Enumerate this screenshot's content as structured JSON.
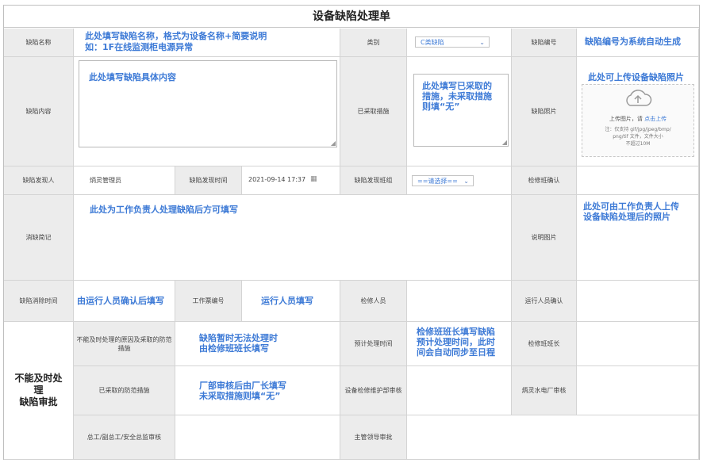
{
  "title": "设备缺陷处理单",
  "row1": {
    "name_label": "缺陷名称",
    "name_hint_line1": "此处填写缺陷名称，格式为设备名称+简要说明",
    "name_hint_line2": "如：1F在线监测柜电源异常",
    "type_label": "类别",
    "type_value": "C类缺陷",
    "code_label": "缺陷编号",
    "code_hint": "缺陷编号为系统自动生成"
  },
  "row2": {
    "content_label": "缺陷内容",
    "content_hint": "此处填写缺陷具体内容",
    "measures_label": "已采取措施",
    "measures_hint_line1": "此处填写已采取的",
    "measures_hint_line2": "措施，未采取措施",
    "measures_hint_line3": "则填“无”",
    "photo_label": "缺陷照片",
    "photo_hint": "此处可上传设备缺陷照片",
    "upload_text": "上传图片，请",
    "upload_link": "点击上传",
    "upload_note_line1": "注：仅支持 gif/jpg/jpeg/bmp/",
    "upload_note_line2": "png/tif 文件，文件大小",
    "upload_note_line3": "不超过10M"
  },
  "row3": {
    "finder_label": "缺陷发现人",
    "finder_value": "炳灵管理员",
    "time_label": "缺陷发现时间",
    "time_value": "2021-09-14 17:37",
    "team_label": "缺陷发现班组",
    "team_value": "==请选择==",
    "confirm_label": "检修班确认"
  },
  "row4": {
    "record_label": "消缺简记",
    "record_hint": "此处为工作负责人处理缺陷后方可填写",
    "photo_label": "说明图片",
    "photo_hint_line1": "此处可由工作负责人上传",
    "photo_hint_line2": "设备缺陷处理后的照片"
  },
  "row5": {
    "elim_label": "缺陷消除时间",
    "elim_hint": "由运行人员确认后填写",
    "ticket_label": "工作票编号",
    "ticket_hint": "运行人员填写",
    "repair_label": "检修人员",
    "op_confirm_label": "运行人员确认"
  },
  "approval": {
    "section_line1": "不能及时处",
    "section_line2": "理",
    "section_line3": "缺陷审批",
    "reason_label": "不能及时处理的原因及采取的防范措施",
    "reason_hint_line1": "缺陷暂时无法处理时",
    "reason_hint_line2": "由检修班班长填写",
    "plan_label": "预计处理时间",
    "plan_hint_line1": "检修班班长填写缺陷",
    "plan_hint_line2": "预计处理时间，此时",
    "plan_hint_line3": "间会自动同步至日程",
    "leader_label": "检修班班长",
    "taken_label": "已采取的防范措施",
    "taken_hint_line1": "厂部审核后由厂长填写",
    "taken_hint_line2": "未采取措施则填“无”",
    "dept_label": "设备检修维护部审核",
    "plant_label": "炳灵水电厂审核",
    "chief_label": "总工/副总工/安全总监审核",
    "supervisor_label": "主管领导审批"
  }
}
